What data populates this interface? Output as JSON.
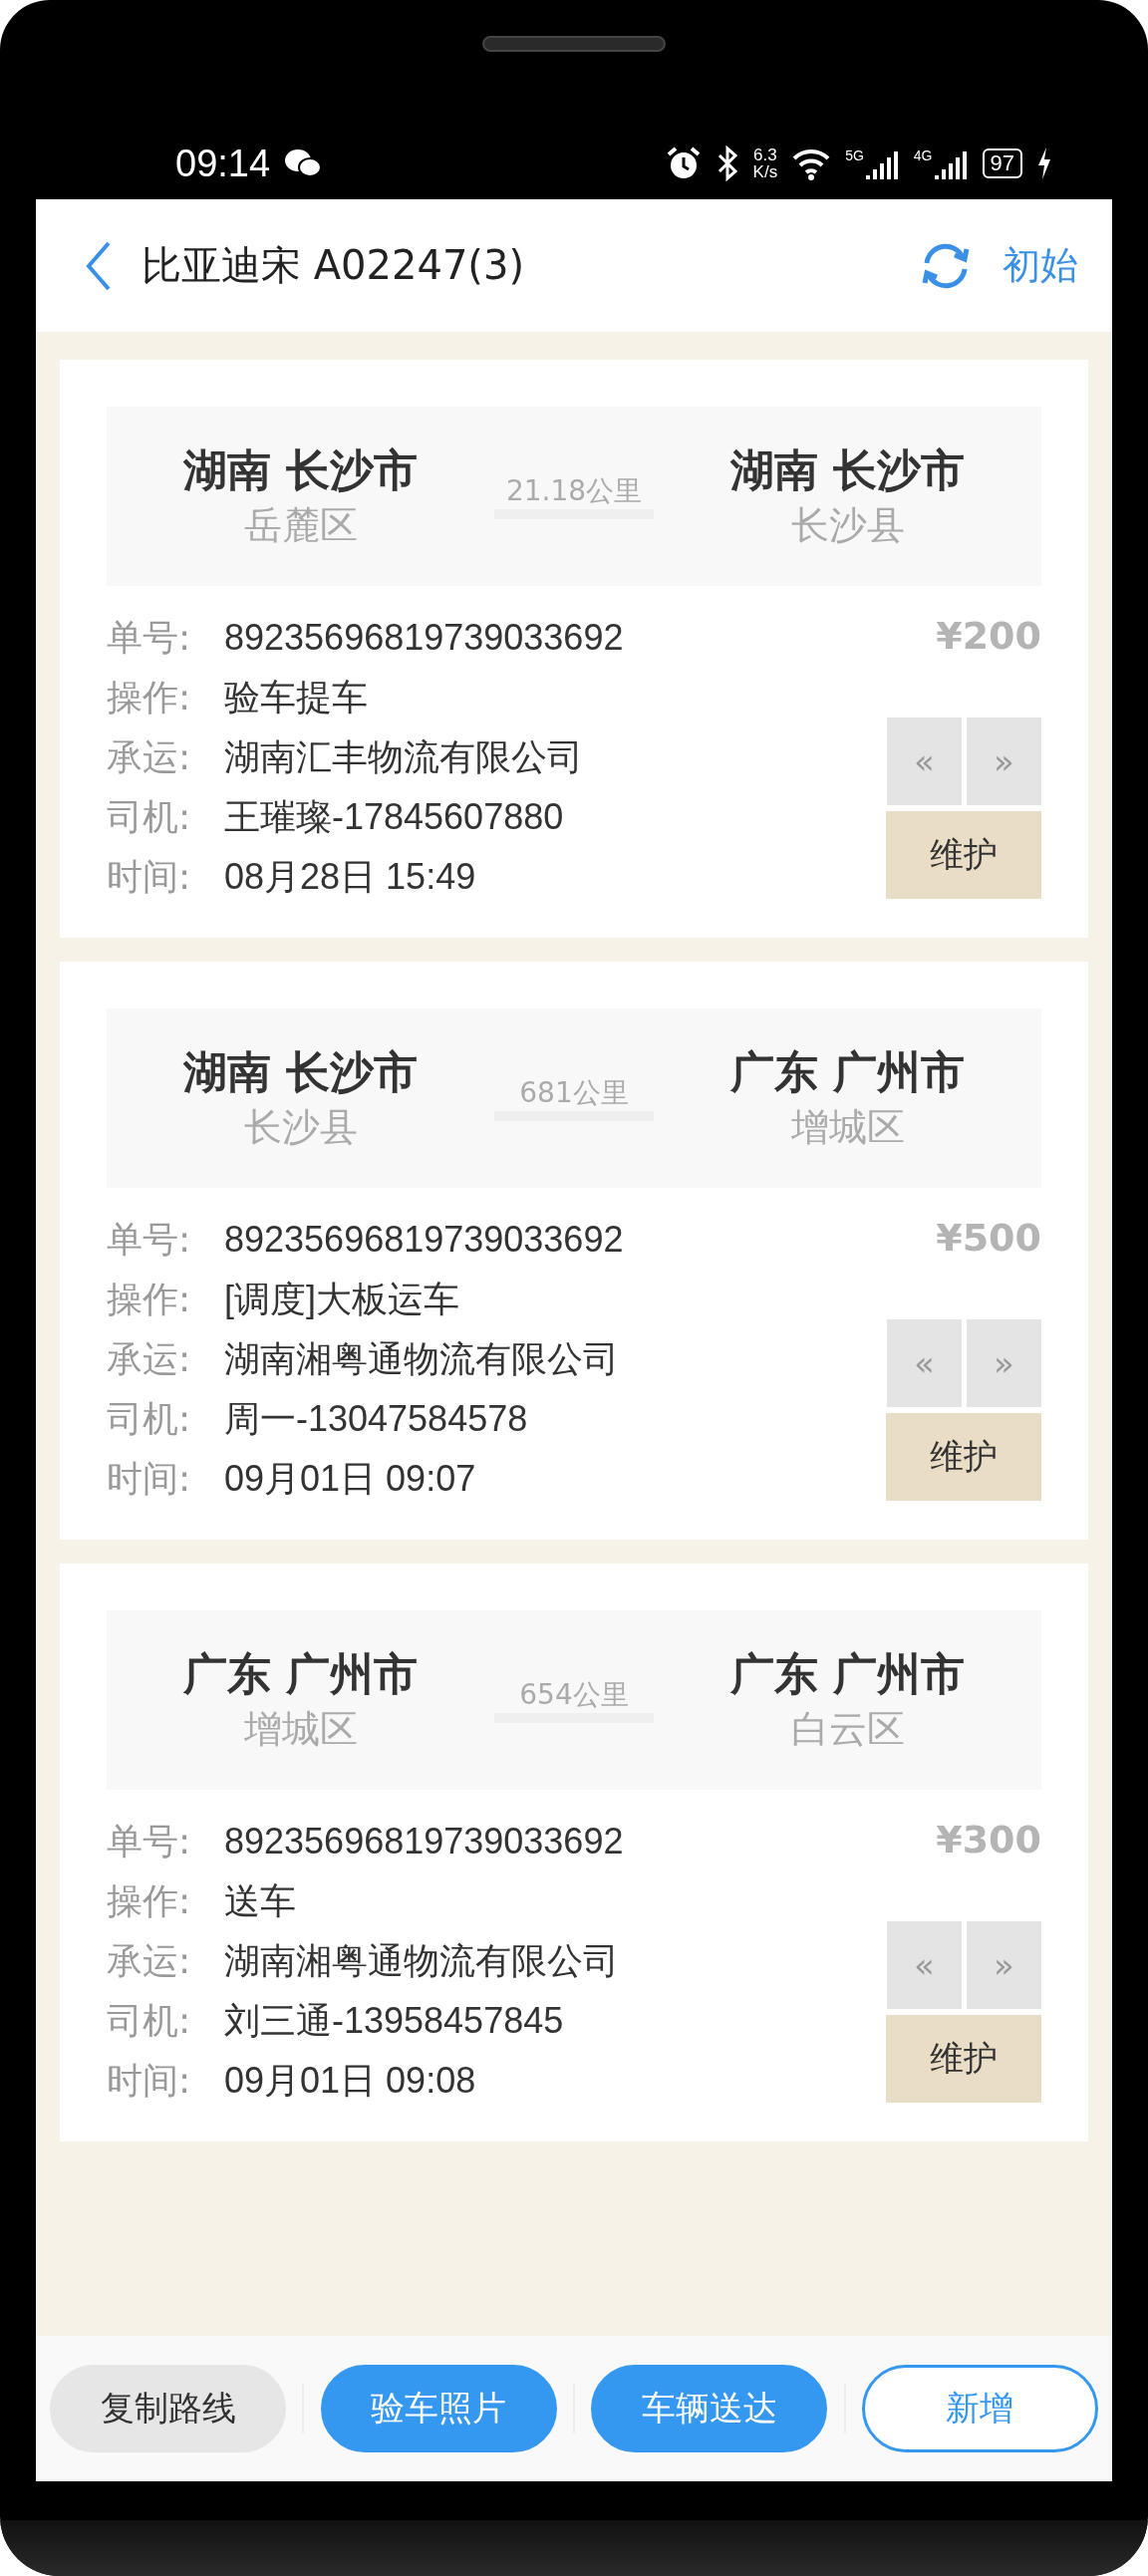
{
  "status_bar": {
    "time": "09:14",
    "speed_value": "6.3",
    "speed_unit": "K/s",
    "signals": [
      "5G",
      "4G"
    ],
    "battery": "97"
  },
  "header": {
    "title": "比亚迪宋 A02247(3)",
    "action": "初始"
  },
  "orders": [
    {
      "from": {
        "city": "湖南 长沙市",
        "district": "岳麓区"
      },
      "distance": "21.18公里",
      "to": {
        "city": "湖南 长沙市",
        "district": "长沙县"
      },
      "price": "¥200",
      "fields": [
        {
          "label": "单号:",
          "value": "89235696819739033692"
        },
        {
          "label": "操作:",
          "value": "验车提车"
        },
        {
          "label": "承运:",
          "value": "湖南汇丰物流有限公司"
        },
        {
          "label": "司机:",
          "value": "王璀璨-17845607880"
        },
        {
          "label": "时间:",
          "value": "08月28日 15:49"
        }
      ],
      "prev": "«",
      "next": "»",
      "maintain": "维护"
    },
    {
      "from": {
        "city": "湖南 长沙市",
        "district": "长沙县"
      },
      "distance": "681公里",
      "to": {
        "city": "广东 广州市",
        "district": "增城区"
      },
      "price": "¥500",
      "fields": [
        {
          "label": "单号:",
          "value": "89235696819739033692"
        },
        {
          "label": "操作:",
          "value": "[调度]大板运车"
        },
        {
          "label": "承运:",
          "value": "湖南湘粤通物流有限公司"
        },
        {
          "label": "司机:",
          "value": "周一-13047584578"
        },
        {
          "label": "时间:",
          "value": "09月01日 09:07"
        }
      ],
      "prev": "«",
      "next": "»",
      "maintain": "维护"
    },
    {
      "from": {
        "city": "广东 广州市",
        "district": "增城区"
      },
      "distance": "654公里",
      "to": {
        "city": "广东 广州市",
        "district": "白云区"
      },
      "price": "¥300",
      "fields": [
        {
          "label": "单号:",
          "value": "89235696819739033692"
        },
        {
          "label": "操作:",
          "value": "送车"
        },
        {
          "label": "承运:",
          "value": "湖南湘粤通物流有限公司"
        },
        {
          "label": "司机:",
          "value": "刘三通-13958457845"
        },
        {
          "label": "时间:",
          "value": "09月01日 09:08"
        }
      ],
      "prev": "«",
      "next": "»",
      "maintain": "维护"
    }
  ],
  "footer_buttons": [
    {
      "label": "复制路线",
      "kind": "gray"
    },
    {
      "label": "验车照片",
      "kind": "primary"
    },
    {
      "label": "车辆送达",
      "kind": "primary"
    },
    {
      "label": "新增",
      "kind": "outline"
    }
  ]
}
